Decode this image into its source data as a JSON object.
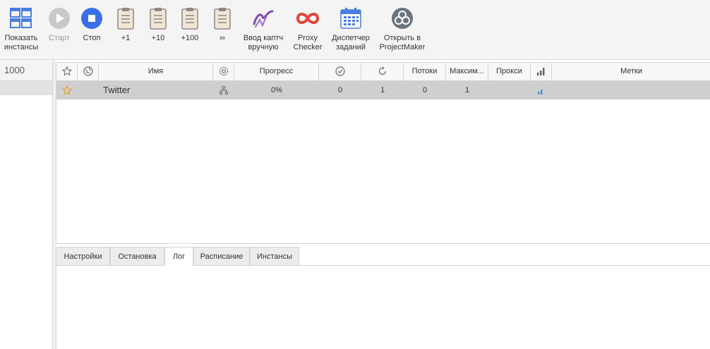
{
  "toolbar": {
    "buttons": [
      {
        "id": "show-instances",
        "label": "Показать\nинстансы",
        "icon": "windows-grid-icon"
      },
      {
        "id": "start",
        "label": "Старт",
        "icon": "play-icon",
        "disabled": true
      },
      {
        "id": "stop",
        "label": "Стоп",
        "icon": "stop-icon"
      },
      {
        "id": "plus1",
        "label": "+1",
        "icon": "clipboard-icon"
      },
      {
        "id": "plus10",
        "label": "+10",
        "icon": "clipboard-icon"
      },
      {
        "id": "plus100",
        "label": "+100",
        "icon": "clipboard-icon"
      },
      {
        "id": "infinite",
        "label": "∞",
        "icon": "clipboard-icon"
      },
      {
        "id": "captcha",
        "label": "Ввод каптч\nвручную",
        "icon": "captcha-icon"
      },
      {
        "id": "proxy",
        "label": "Proxy\nChecker",
        "icon": "infinity-icon"
      },
      {
        "id": "scheduler",
        "label": "Диспетчер\nзаданий",
        "icon": "calendar-icon"
      },
      {
        "id": "projectmaker",
        "label": "Открыть в\nProjectMaker",
        "icon": "projectmaker-icon"
      }
    ]
  },
  "leftpane": {
    "count": "1000"
  },
  "table": {
    "headers": {
      "name": "Имя",
      "progress": "Прогресс",
      "threads": "Потоки",
      "max": "Максим...",
      "proxy": "Прокси",
      "tags": "Метки"
    },
    "rows": [
      {
        "name": "Twitter",
        "progress": "0%",
        "done": "0",
        "repeats": "1",
        "threads": "0",
        "max": "1",
        "proxy": "",
        "tags": ""
      }
    ]
  },
  "tabs": [
    "Настройки",
    "Остановка",
    "Лог",
    "Расписание",
    "Инстансы"
  ],
  "active_tab": "Лог",
  "colors": {
    "accent": "#4a7de0",
    "stop": "#3b6fe8",
    "proxy": "#e0463c",
    "captcha": "#7d4ab8",
    "star": "#e6a23c"
  }
}
